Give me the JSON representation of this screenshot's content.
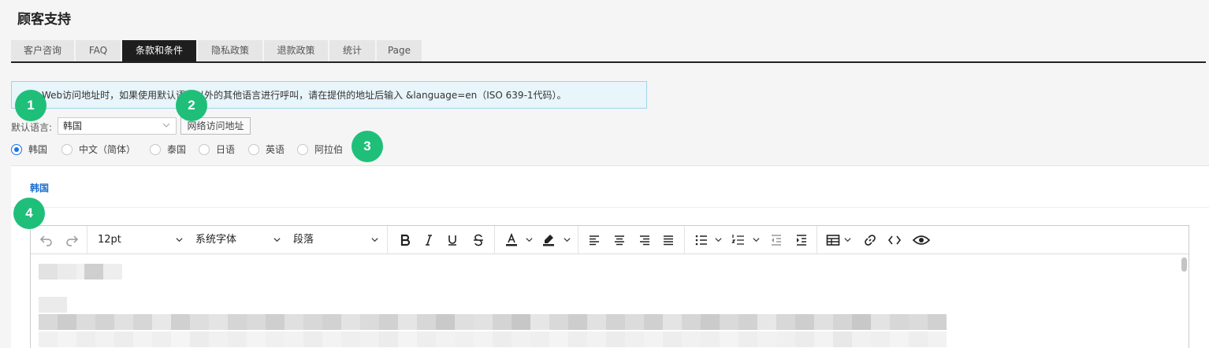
{
  "page_title": "顾客支持",
  "tabs": [
    {
      "label": "客户咨询",
      "active": false
    },
    {
      "label": "FAQ",
      "active": false
    },
    {
      "label": "条款和条件",
      "active": true
    },
    {
      "label": "隐私政策",
      "active": false
    },
    {
      "label": "退款政策",
      "active": false
    },
    {
      "label": "统计",
      "active": false
    },
    {
      "label": "Page",
      "active": false
    }
  ],
  "info_message": "Web访问地址时，如果使用默认语言以外的其他语言进行呼叫，请在提供的地址后输入 &language=en（ISO 639-1代码）。",
  "default_language": {
    "label": "默认语言:",
    "selected": "韩国"
  },
  "url_button_label": "网络访问地址",
  "language_options": [
    {
      "label": "韩国",
      "checked": true
    },
    {
      "label": "中文（简体）",
      "checked": false
    },
    {
      "label": "泰国",
      "checked": false
    },
    {
      "label": "日语",
      "checked": false
    },
    {
      "label": "英语",
      "checked": false
    },
    {
      "label": "阿拉伯",
      "checked": false
    }
  ],
  "panel_heading": "韩国",
  "editor": {
    "font_size": "12pt",
    "font_family": "系统字体",
    "block_format": "段落",
    "icons": [
      "undo-icon",
      "redo-icon",
      "bold-icon",
      "italic-icon",
      "underline-icon",
      "strikethrough-icon",
      "text-color-icon",
      "highlight-icon",
      "align-left-icon",
      "align-center-icon",
      "align-right-icon",
      "justify-icon",
      "bullet-list-icon",
      "numbered-list-icon",
      "outdent-icon",
      "indent-icon",
      "table-icon",
      "link-icon",
      "code-icon",
      "preview-icon"
    ]
  },
  "badges": [
    "1",
    "2",
    "3",
    "4"
  ],
  "colors": {
    "accent": "#1a73e8",
    "heading_blue": "#1a6fd1",
    "badge_green": "#1fbf7a",
    "active_tab": "#1e1e1e",
    "info_bg": "#e8f5fb"
  }
}
